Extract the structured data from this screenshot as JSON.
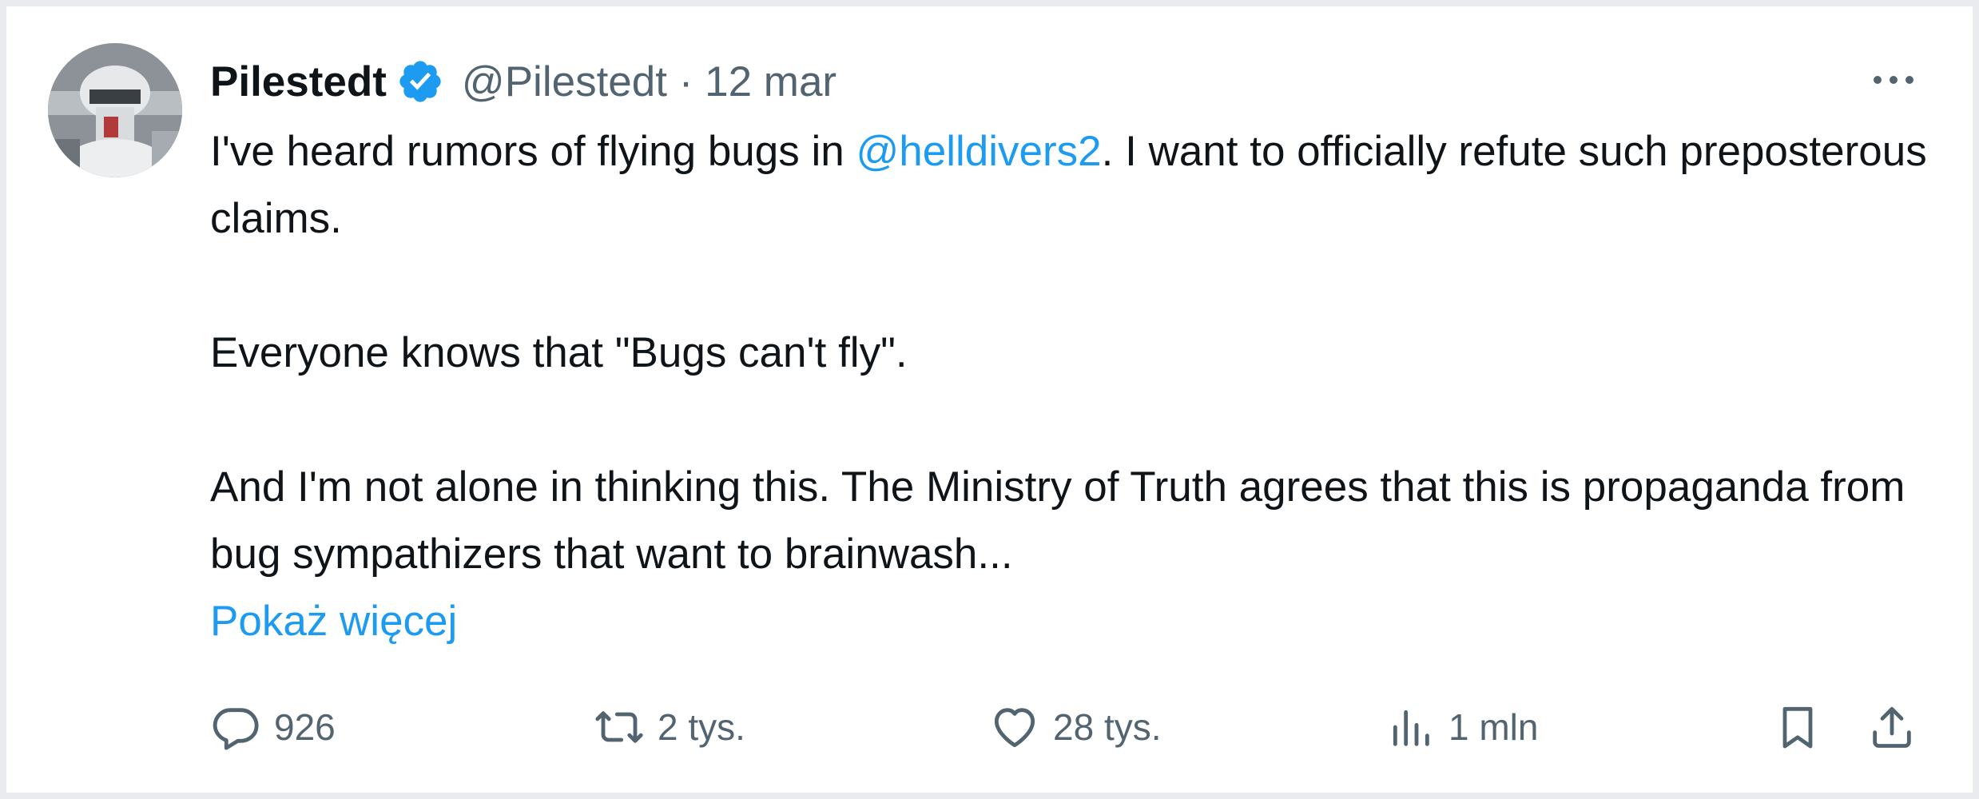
{
  "author": {
    "display_name": "Pilestedt",
    "handle": "@Pilestedt",
    "separator": "·",
    "date": "12 mar"
  },
  "tweet": {
    "text_line1_prefix": "I've heard rumors of flying bugs in ",
    "mention": "@helldivers2",
    "text_line1_suffix": ". I want to officially refute such preposterous claims.",
    "paragraph2": "Everyone knows that \"Bugs can't fly\".",
    "paragraph3": "And I'm not alone in thinking this. The Ministry of Truth agrees that this is propaganda from bug sympathizers that want to brainwash...",
    "show_more": "Pokaż więcej"
  },
  "actions": {
    "replies": "926",
    "reposts": "2 tys.",
    "likes": "28 tys.",
    "views": "1 mln"
  },
  "icons": {
    "verified": "verified-badge-icon",
    "more": "more-dots-icon",
    "reply": "reply-bubble-icon",
    "repost": "repost-arrows-icon",
    "like": "heart-icon",
    "views": "bar-chart-icon",
    "bookmark": "bookmark-icon",
    "share": "share-upload-icon"
  },
  "colors": {
    "link": "#1d9bf0",
    "muted": "#536471",
    "text": "#0f1419",
    "verified": "#1d9bf0"
  }
}
